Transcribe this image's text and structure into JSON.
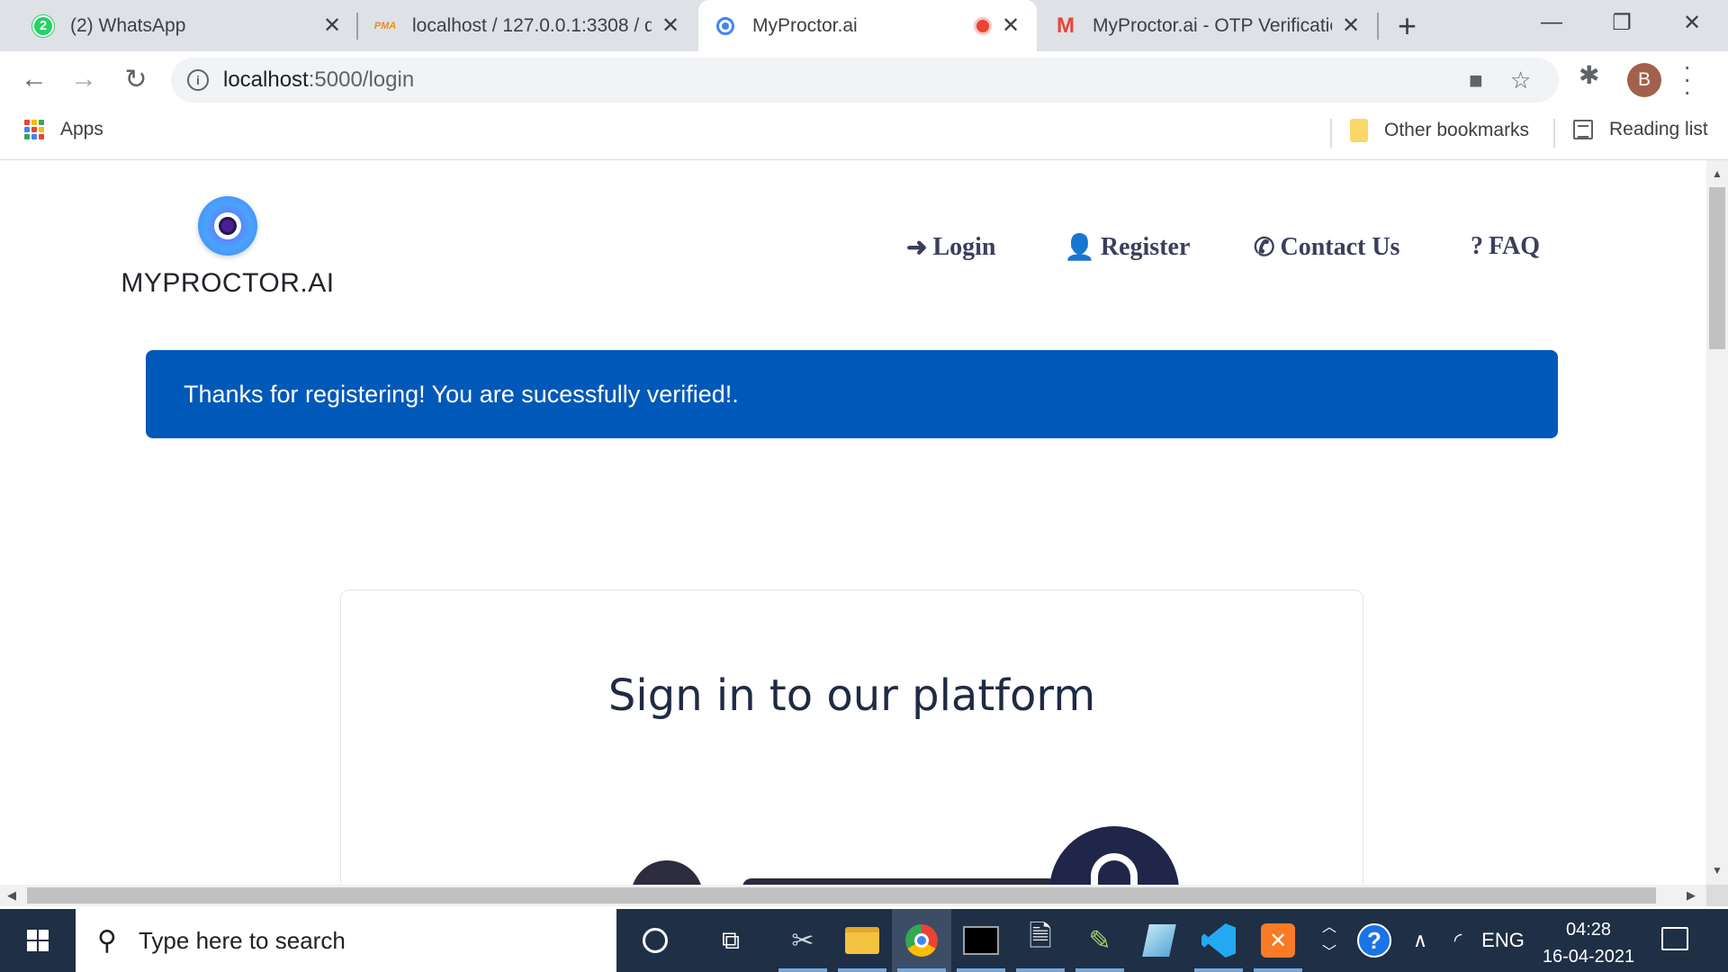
{
  "browser": {
    "tabs": [
      {
        "title": "(2) WhatsApp",
        "badge": "2",
        "active": false
      },
      {
        "title": "localhost / 127.0.0.1:3308 / q",
        "favicon_text": "PMA",
        "active": false
      },
      {
        "title": "MyProctor.ai",
        "active": true,
        "recording": true
      },
      {
        "title": "MyProctor.ai - OTP Verificatio",
        "favicon_text": "M",
        "active": false
      }
    ],
    "new_tab_label": "+",
    "window_controls": {
      "minimize": "—",
      "restore": "❐",
      "close": "✕"
    },
    "address": {
      "host": "localhost",
      "path": ":5000/login"
    },
    "profile_initial": "B",
    "bookmarks": {
      "apps": "Apps",
      "other": "Other bookmarks",
      "reading": "Reading list"
    }
  },
  "site": {
    "brand": "MYPROCTOR.AI",
    "nav": [
      {
        "label": "Login",
        "icon": "sign-in-icon"
      },
      {
        "label": "Register",
        "icon": "user-plus-icon"
      },
      {
        "label": "Contact Us",
        "icon": "phone-icon"
      },
      {
        "label": "FAQ",
        "icon": "question-icon"
      }
    ],
    "alert": "Thanks for registering! You are sucessfully verified!.",
    "alert_color": "#0059b8",
    "card_title": "Sign in to our platform"
  },
  "taskbar": {
    "search_placeholder": "Type here to search",
    "language": "ENG",
    "time": "04:28",
    "date": "16-04-2021"
  }
}
